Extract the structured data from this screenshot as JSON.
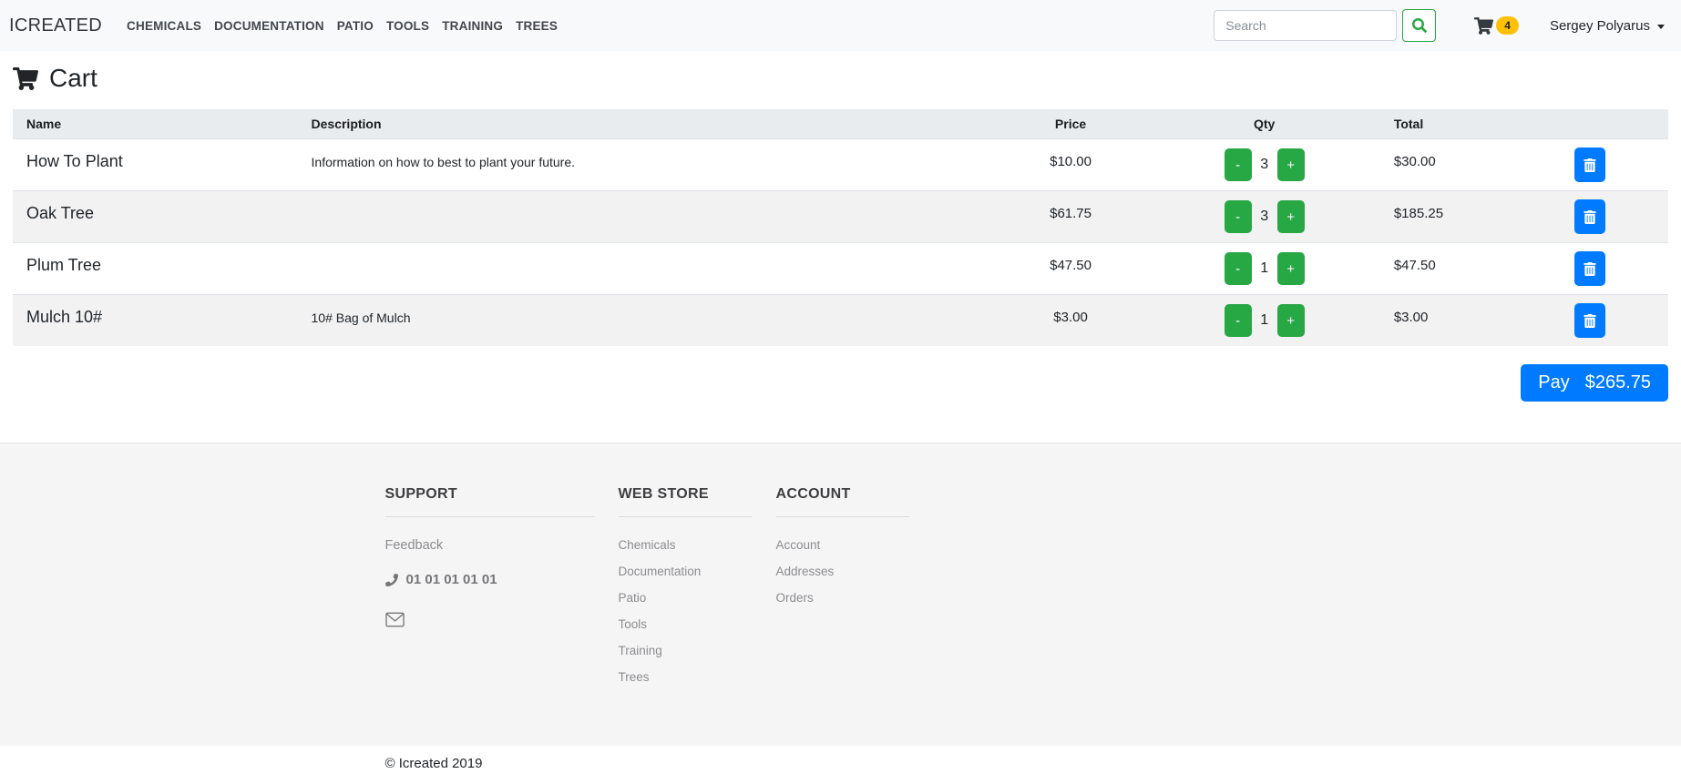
{
  "navbar": {
    "brand": "ICREATED",
    "links": [
      "CHEMICALS",
      "DOCUMENTATION",
      "PATIO",
      "TOOLS",
      "TRAINING",
      "TREES"
    ],
    "search_placeholder": "Search",
    "cart_count": "4",
    "user_name": "Sergey Polyarus"
  },
  "page": {
    "title": "Cart"
  },
  "cart": {
    "columns": {
      "name": "Name",
      "description": "Description",
      "price": "Price",
      "qty": "Qty",
      "total": "Total"
    },
    "qty_minus": "-",
    "qty_plus": "+",
    "items": [
      {
        "name": "How To Plant",
        "description": "Information on how to best to plant your future.",
        "price": "$10.00",
        "qty": "3",
        "total": "$30.00"
      },
      {
        "name": "Oak Tree",
        "description": "",
        "price": "$61.75",
        "qty": "3",
        "total": "$185.25"
      },
      {
        "name": "Plum Tree",
        "description": "",
        "price": "$47.50",
        "qty": "1",
        "total": "$47.50"
      },
      {
        "name": "Mulch 10#",
        "description": "10# Bag of Mulch",
        "price": "$3.00",
        "qty": "1",
        "total": "$3.00"
      }
    ],
    "pay": {
      "label": "Pay",
      "amount": "$265.75"
    }
  },
  "footer": {
    "support": {
      "title": "SUPPORT",
      "feedback": "Feedback",
      "phone": "01 01 01 01 01"
    },
    "webstore": {
      "title": "WEB STORE",
      "links": [
        "Chemicals",
        "Documentation",
        "Patio",
        "Tools",
        "Training",
        "Trees"
      ]
    },
    "account": {
      "title": "ACCOUNT",
      "links": [
        "Account",
        "Addresses",
        "Orders"
      ]
    },
    "copyright": "© Icreated 2019"
  },
  "colors": {
    "primary": "#007bff",
    "success": "#28a745",
    "warning_badge": "#ffc107",
    "navbar_bg": "#f8f9fa",
    "table_head_bg": "#e9ecef",
    "stripe_bg": "#f2f2f3",
    "footer_bg": "#f5f5f6"
  }
}
